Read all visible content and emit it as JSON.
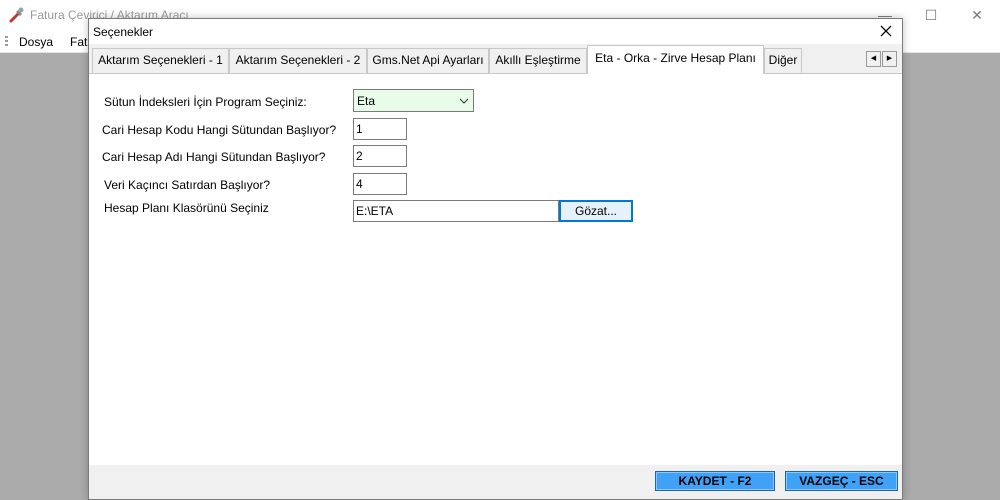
{
  "main_window": {
    "title": "Fatura Çevirici / Aktarım Aracı",
    "controls": {
      "minimize": "—",
      "maximize": "☐",
      "close": "✕"
    },
    "menu": [
      "Dosya",
      "Fatu"
    ]
  },
  "dialog": {
    "title": "Seçenekler",
    "close_glyph": "✕",
    "tabs": [
      "Aktarım Seçenekleri - 1",
      "Aktarım Seçenekleri - 2",
      "Gms.Net Api Ayarları",
      "Akıllı Eşleştirme",
      "Eta - Orka - Zirve Hesap Planı",
      "Diğer"
    ],
    "active_tab": "Eta - Orka - Zirve Hesap Planı",
    "tab_scroll": {
      "left": "◀",
      "right": "▶"
    },
    "form": {
      "program_label": "Sütun İndeksleri İçin Program Seçiniz:",
      "program_value": "Eta",
      "account_code_label": "Cari Hesap Kodu Hangi Sütundan Başlıyor?",
      "account_code_value": "1",
      "account_name_label": "Cari Hesap Adı Hangi Sütundan Başlıyor?",
      "account_name_value": "2",
      "start_row_label": "Veri Kaçıncı Satırdan Başlıyor?",
      "start_row_value": "4",
      "folder_label": "Hesap Planı Klasörünü Seçiniz",
      "folder_value": "E:\\ETA",
      "browse_label": "Gözat..."
    },
    "footer": {
      "save_label": "KAYDET - F2",
      "cancel_label": "VAZGEÇ - ESC"
    }
  },
  "colors": {
    "combo_background": "#e9fbe9",
    "footer_button": "#3fa2f7",
    "focus_border": "#0078d7",
    "desktop_gray": "#ababab"
  }
}
